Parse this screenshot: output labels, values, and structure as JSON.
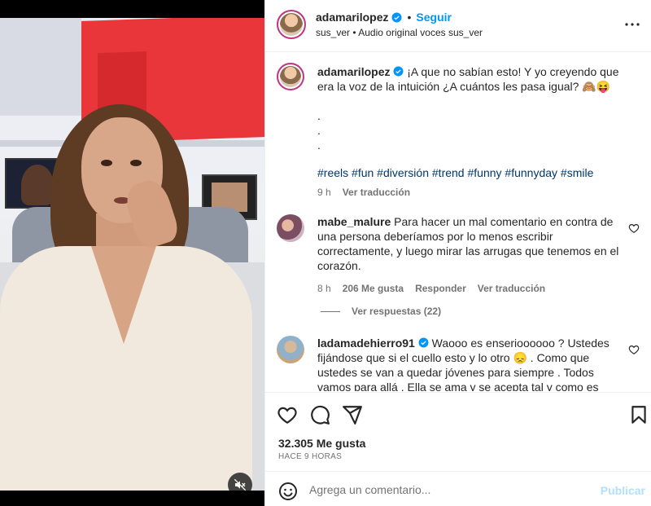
{
  "post": {
    "username": "adamarilopez",
    "follow_label": "Seguir",
    "separator": "•",
    "subline_user": "sus_ver",
    "subline_audio": "Audio original voces sus_ver",
    "caption_user": "adamarilopez",
    "caption_text": "¡A que no sabían esto! Y yo creyendo que era la voz de la intuición ¿A cuántos les pasa igual? 🙈😝",
    "caption_dots": [
      ".",
      ".",
      "."
    ],
    "hashtags": [
      "#reels",
      "#fun",
      "#diversión",
      "#trend",
      "#funny",
      "#funnyday",
      "#smile"
    ],
    "caption_time": "9 h",
    "translate_label": "Ver traducción",
    "likes": "32.305 Me gusta",
    "ago": "HACE 9 HORAS"
  },
  "comments": [
    {
      "user": "mabe_malure",
      "text": "Para hacer un mal comentario en contra de una persona deberíamos por lo menos escribir correctamente, y luego mirar las arrugas que tenemos en el corazón.",
      "time": "8 h",
      "likes": "206 Me gusta",
      "reply": "Responder",
      "translate": "Ver traducción",
      "view_replies": "Ver respuestas (22)"
    },
    {
      "user": "ladamadehierro91",
      "text": "Waooo es enserioooooo ? Ustedes fijándose que si el cuello esto y lo otro 😞 . Como que ustedes se van a quedar jóvenes para siempre . Todos vamos para allá . Ella se ama y se acepta tal y como es"
    }
  ],
  "composer": {
    "placeholder": "Agrega un comentario...",
    "publish_label": "Publicar"
  },
  "icons": {
    "verified": "verified-badge-icon",
    "more": "more-options-icon",
    "like": "heart-icon",
    "comment": "comment-icon",
    "share": "share-icon",
    "save": "bookmark-icon",
    "emoji": "emoji-icon",
    "mute": "muted-speaker-icon"
  },
  "colors": {
    "accent": "#0095f6",
    "hashtag": "#00376b",
    "muted": "#737373",
    "publish_disabled": "#b2dffc"
  }
}
